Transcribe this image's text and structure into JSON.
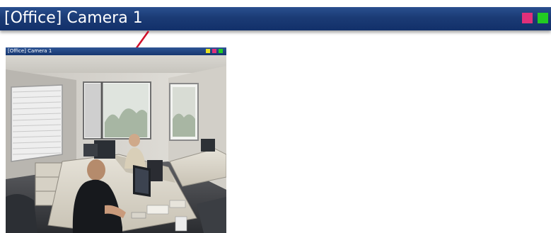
{
  "camera_header": {
    "title": "[Office] Camera 1",
    "indicators": [
      {
        "name": "alert-indicator",
        "color": "#e0307a"
      },
      {
        "name": "status-indicator",
        "color": "#22cc22"
      }
    ]
  },
  "camera_view": {
    "title": "[Office] Camera 1",
    "indicators": [
      {
        "name": "yellow-indicator",
        "color": "#e8e020"
      },
      {
        "name": "alert-indicator",
        "color": "#e0307a"
      },
      {
        "name": "status-indicator",
        "color": "#22cc22"
      }
    ]
  },
  "colors": {
    "title_bar": "#1b3b75",
    "connector": "#d0102a"
  }
}
